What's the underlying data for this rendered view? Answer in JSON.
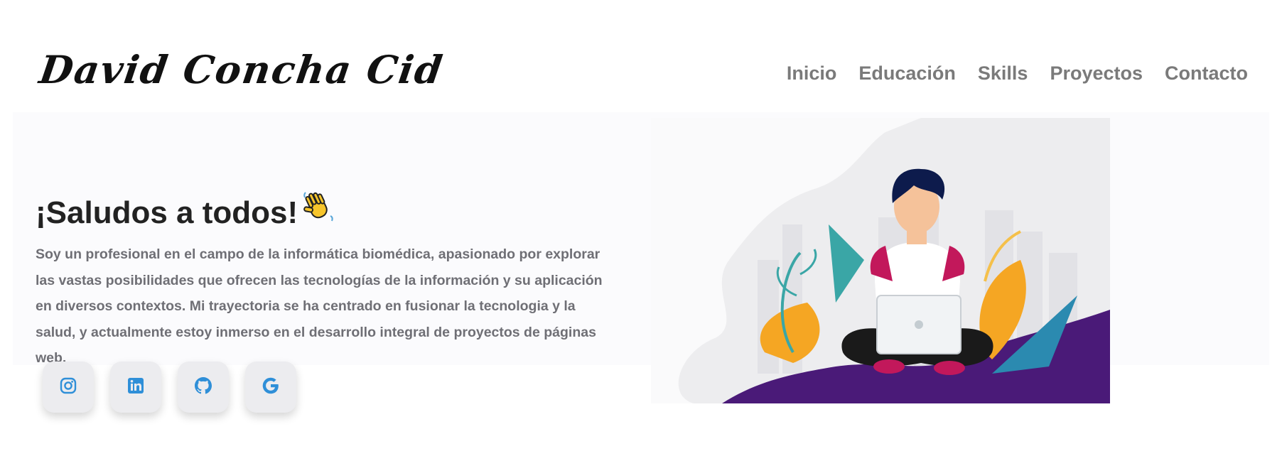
{
  "header": {
    "logo_text": "David Concha Cid",
    "nav": [
      "Inicio",
      "Educación",
      "Skills",
      "Proyectos",
      "Contacto"
    ]
  },
  "hero": {
    "title": "¡Saludos a todos!",
    "title_emoji": "👋",
    "intro": "Soy un profesional en el campo de la informática biomédica, apasionado por explorar las vastas posibilidades que ofrecen las tecnologías de la información y su aplicación en diversos contextos. Mi trayectoria se ha centrado en fusionar la tecnologia y la salud, y actualmente estoy inmerso en el desarrollo integral de proyectos de páginas web."
  },
  "socials": [
    {
      "name": "instagram-icon"
    },
    {
      "name": "linkedin-icon"
    },
    {
      "name": "github-icon"
    },
    {
      "name": "google-icon"
    }
  ],
  "colors": {
    "accent": "#2f8fd8",
    "nav_text": "#7a7a7a",
    "body_text": "#6f6f75",
    "illustration_purple": "#4a1a78"
  }
}
